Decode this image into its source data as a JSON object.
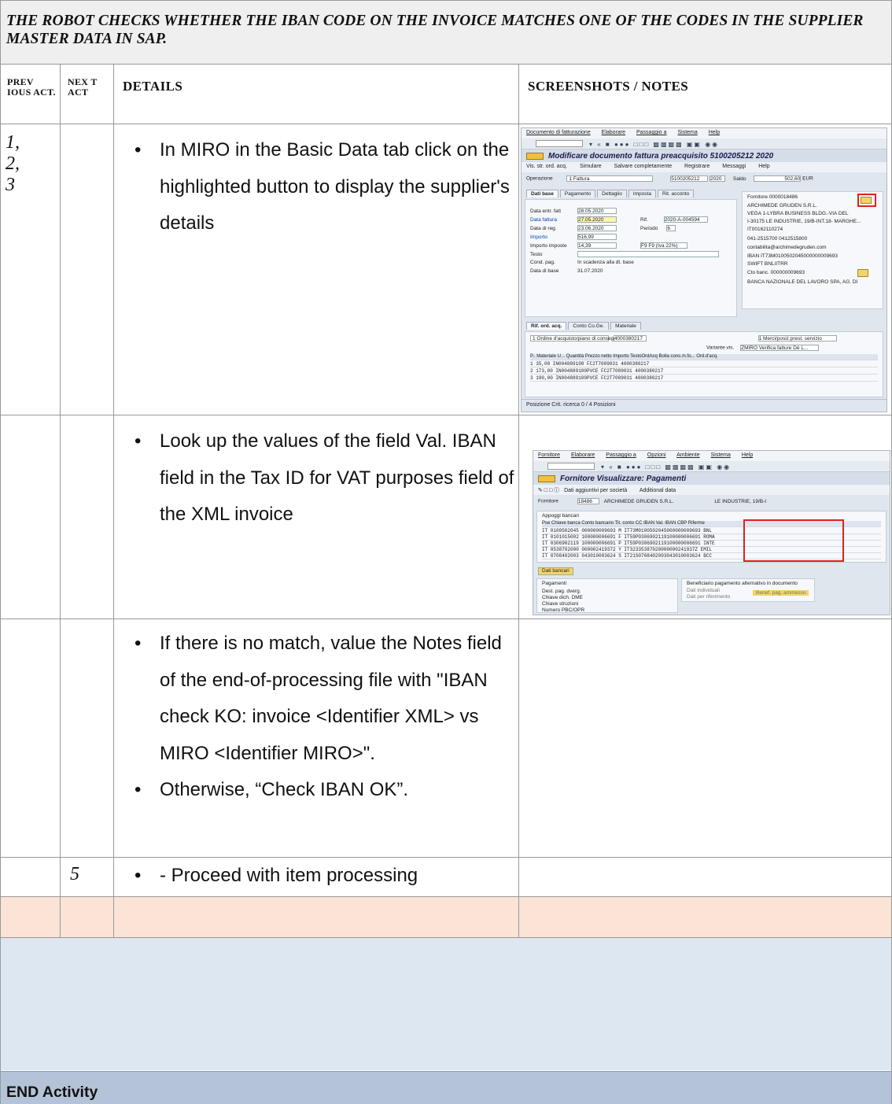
{
  "title": "The robot checks whether the IBAN code on the invoice matches one of the codes in the supplier master data in SAP.",
  "headers": {
    "prev": "Prev ious Act.",
    "next": "Nex t Act",
    "details": "Details",
    "notes": "Screenshots / Notes"
  },
  "rows": [
    {
      "prev": "1,\n2,\n3",
      "next": "",
      "bullets": [
        "In MIRO in the Basic Data tab click on the highlighted button to display the supplier's details"
      ]
    },
    {
      "prev": "",
      "next": "",
      "bullets": [
        "Look up the values of the field Val. IBAN field in the Tax ID for VAT purposes field of the XML invoice"
      ]
    },
    {
      "prev": "",
      "next": "",
      "bullets": [
        "If there is no match, value the Notes field of the end-of-processing file with \"IBAN check KO: invoice <Identifier XML> vs MIRO <Identifier MIRO>\".",
        "Otherwise, “Check IBAN OK”."
      ]
    },
    {
      "prev": "",
      "next": "5",
      "bullets": [
        "- Proceed with item processing"
      ]
    }
  ],
  "screenshot1": {
    "menu": [
      "Documento di fatturazione",
      "Elaborare",
      "Passaggio a",
      "Sistema",
      "Help"
    ],
    "title": "Modificare documento fattura preacquisito 5100205212 2020",
    "appbar": [
      "Vis. str. ord. acq.",
      "Simulare",
      "Salvare completamente",
      "Registrare",
      "Messaggi",
      "Help"
    ],
    "operazione_label": "Operazione",
    "operazione_value": "1 Fattura",
    "doc_number": "5100205212",
    "year": "2020",
    "saldo_label": "Saldo",
    "saldo_value": "502,60",
    "currency": "EUR",
    "tabs": [
      "Dati base",
      "Pagamento",
      "Dettaglio",
      "Imposta",
      "Rit. acconto"
    ],
    "fields": [
      {
        "label": "Data entr. fatt",
        "value": "28.05.2020"
      },
      {
        "label": "Data fattura",
        "value": "27.05.2020"
      },
      {
        "label": "Data di reg.",
        "value": "23.06.2020"
      },
      {
        "label": "Importo",
        "value": "516,99"
      },
      {
        "label": "Importo imposte",
        "value": "14,39"
      },
      {
        "label": "Testo",
        "value": ""
      },
      {
        "label": "Cond. pag.",
        "value": "In scadenza alla dt. base"
      },
      {
        "label": "Data di base",
        "value": "31.07.2020"
      }
    ],
    "rif_label": "Rif.",
    "rif_value": "2020-A-004594",
    "periodo_label": "Periodo",
    "periodo_value": "6",
    "tax_code": "F9 F9 (Iva 22%)",
    "supplier_header": "Fornitore 0000018486",
    "supplier_lines": [
      "ARCHIMEDE GRUDEN S.R.L.",
      "VEGA 1-LYBRA BUSINESS BLDG.-VIA DEL",
      "I-30175 LE INDUSTRIE, 19/B-INT.18- MARGHE...",
      "IT00162110274",
      "041-2515700        0412515800",
      "contabilita@archimedegruden.com",
      "IBAN    IT73M0100502045000000009693",
      "SWIFT   BNLIITRR",
      "Cto banc.   000000009693",
      "BANCA NAZIONALE DEL LAVORO SPA, AG. DI"
    ],
    "lower_tabs": [
      "Rif. ord. acq.",
      "Conto Co.Ge.",
      "Materiale"
    ],
    "order_type": "1 Ordine d'acquisto/piano di consegna",
    "order_no": "4000380217",
    "service_label": "1 Merci/posiz.prest. servizio",
    "variant_label": "Variante vis.",
    "variant_value": "ZMIRO Verifica fatture Dé L...",
    "table_header": "P.. Materiale   U...  Quantità   Prezzo netto  Importo   TestoOrdAcq        Bolla cons./n.fo...  Ord.d'acq.",
    "table_rows": [
      "1                            35,00        IN004889108      FC2T7089031   4000380217",
      "2                           173,00        IN004889100PVCE  FC2T7089031   4000380217",
      "3                           190,00        IN004889100PVCE  FC2T7089031   4000380217"
    ],
    "status": "Posizione      Crit. ricerca                       0 / 4      Posizioni"
  },
  "screenshot2": {
    "menu": [
      "Fornitore",
      "Elaborare",
      "Passaggio a",
      "Opzioni",
      "Ambiente",
      "Sistema",
      "Help"
    ],
    "title": "Fornitore Visualizzare: Pagamenti",
    "appbar": [
      "Dati aggiuntivi per società",
      "Additional data"
    ],
    "supplier_label": "Fornitore",
    "supplier_id": "18486",
    "supplier_name": "ARCHIMEDE GRUDEN S.R.L.",
    "supplier_addr": "LE INDUSTRIE, 19/B-I",
    "section": "Appoggi bancari",
    "table_header": "Pse Chiave banca   Conto bancario   Tit. conto                     CC IBAN Val. IBAN                        CBP  Riferme",
    "table_rows": [
      "IT  0100502045    000000009693                                  M     IT73M0100502045000000009693      BNL",
      "IT  0101015002    100000006691                                  F     IT59P0306902119100000006691      ROMA",
      "IT  0306902119    100000006691                                  P     IT59P0306902119100000006691      INTE",
      "IT  0538702000    000002419372                                  Y     IT32335387020000000241937Z       EMIL",
      "IT  0708402003    043010003624                                  S     IT21S0708402003043010003624      BCC"
    ],
    "bank_button": "Dati bancari",
    "payments_label": "Pagamenti",
    "payments_fields": [
      "Dest. pag. dverg.",
      "Chiave dich. DME",
      "Chiave struzioni",
      "Numero PBC/OPR"
    ],
    "alt_label": "Beneficiario pagamento alternativo in documento",
    "alt_options": [
      "Dati individuali",
      "Dati per riferimento"
    ],
    "alt_button": "Benef. pag. ammesso"
  },
  "end_activity": "END Activity",
  "colors": {
    "title_bg": "#efefef",
    "peach_row": "#fbe3d6",
    "blue_row": "#dde7f2",
    "end_row": "#b4c3d7",
    "highlight": "#e02020"
  }
}
